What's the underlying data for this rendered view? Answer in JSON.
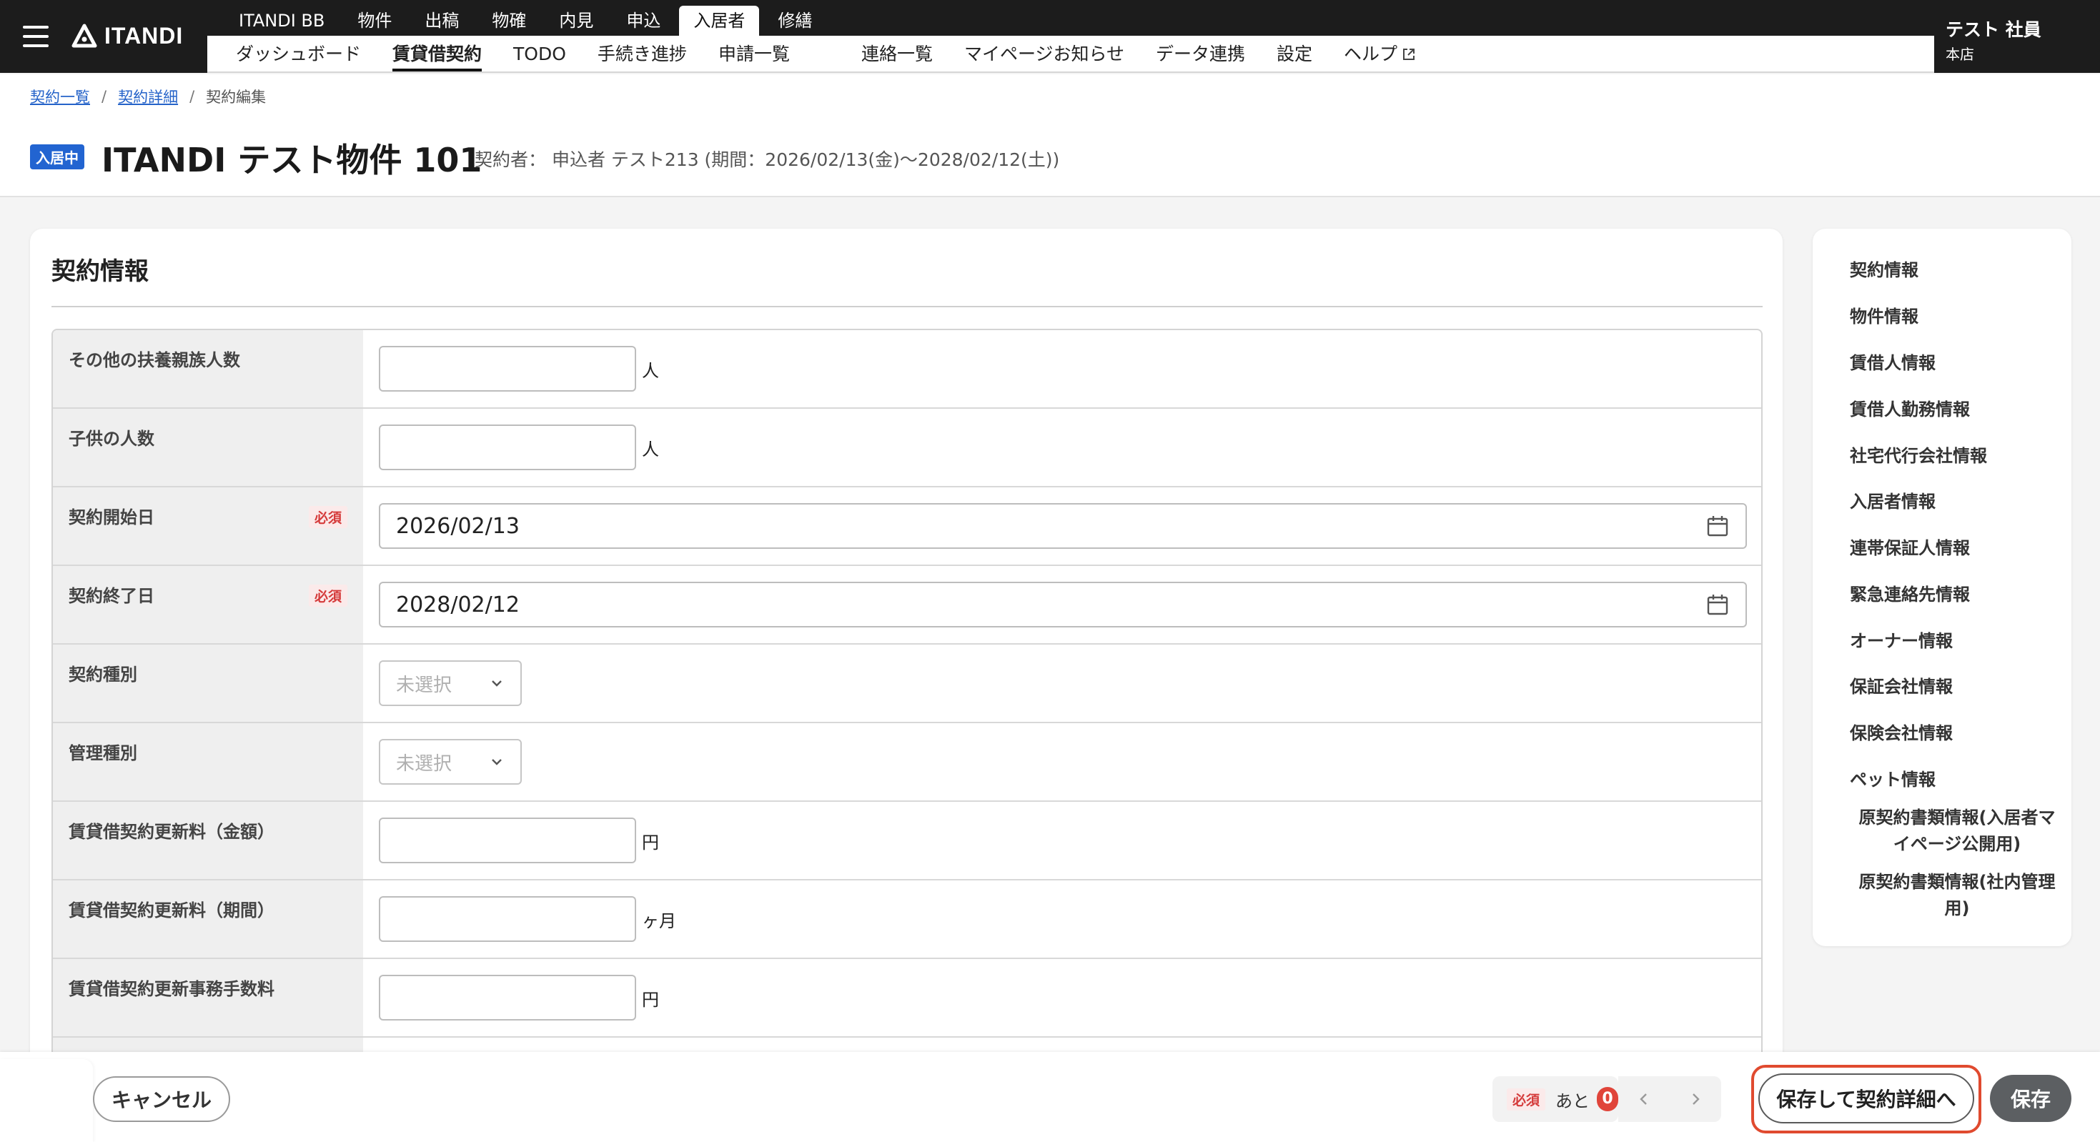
{
  "header": {
    "brand": "ITANDI",
    "product_tabs": [
      {
        "label": "ITANDI BB",
        "active": false
      },
      {
        "label": "物件",
        "active": false
      },
      {
        "label": "出稿",
        "active": false
      },
      {
        "label": "物確",
        "active": false
      },
      {
        "label": "内見",
        "active": false
      },
      {
        "label": "申込",
        "active": false
      },
      {
        "label": "入居者",
        "active": true
      },
      {
        "label": "修繕",
        "active": false
      }
    ],
    "sub_nav": [
      {
        "label": "ダッシュボード",
        "active": false
      },
      {
        "label": "賃貸借契約",
        "active": true
      },
      {
        "label": "TODO",
        "active": false
      },
      {
        "label": "手続き進捗",
        "active": false
      },
      {
        "label": "申請一覧",
        "active": false
      },
      {
        "label": "連絡一覧",
        "active": false
      },
      {
        "label": "マイページお知らせ",
        "active": false
      },
      {
        "label": "データ連携",
        "active": false
      },
      {
        "label": "設定",
        "active": false
      },
      {
        "label": "ヘルプ",
        "active": false
      }
    ],
    "user": {
      "name": "テスト 社員",
      "branch": "本店"
    }
  },
  "breadcrumb": {
    "items": [
      "契約一覧",
      "契約詳細",
      "契約編集"
    ],
    "separator": "/"
  },
  "page": {
    "status_tag": "入居中",
    "title": "ITANDI テスト物件 101",
    "meta": "契約者： 申込者 テスト213 (期間：2026/02/13(金)〜2028/02/12(土))"
  },
  "form": {
    "section_title": "契約情報",
    "required_label": "必須",
    "rows": [
      {
        "label": "その他の扶養親族人数",
        "type": "text",
        "value": "",
        "unit": "人"
      },
      {
        "label": "子供の人数",
        "type": "text",
        "value": "",
        "unit": "人"
      },
      {
        "label": "契約開始日",
        "type": "date",
        "value": "2026/02/13",
        "required": true
      },
      {
        "label": "契約終了日",
        "type": "date",
        "value": "2028/02/12",
        "required": true
      },
      {
        "label": "契約種別",
        "type": "select",
        "value": "未選択"
      },
      {
        "label": "管理種別",
        "type": "select",
        "value": "未選択"
      },
      {
        "label": "賃貸借契約更新料（金額）",
        "type": "text",
        "value": "",
        "unit": "円"
      },
      {
        "label": "賃貸借契約更新料（期間）",
        "type": "text",
        "value": "",
        "unit": "ヶ月"
      },
      {
        "label": "賃貸借契約更新事務手数料",
        "type": "text",
        "value": "",
        "unit": "円"
      }
    ]
  },
  "side_nav": {
    "items": [
      "契約情報",
      "物件情報",
      "賃借人情報",
      "賃借人勤務情報",
      "社宅代行会社情報",
      "入居者情報",
      "連帯保証人情報",
      "緊急連絡先情報",
      "オーナー情報",
      "保証会社情報",
      "保険会社情報",
      "ペット情報",
      "原契約書類情報(入居者マイページ公開用)",
      "原契約書類情報(社内管理用)"
    ]
  },
  "footer": {
    "cancel_label": "キャンセル",
    "required_tag": "必須",
    "remaining_label": "あと",
    "remaining_count": "0",
    "save_and_detail_label": "保存して契約詳細へ",
    "save_label": "保存"
  },
  "colors": {
    "header_bg": "#1c1c1c",
    "status_tag": "#2264d1",
    "required": "#d53b3b",
    "highlight": "#e04a2f",
    "save_button": "#5c5f62"
  }
}
